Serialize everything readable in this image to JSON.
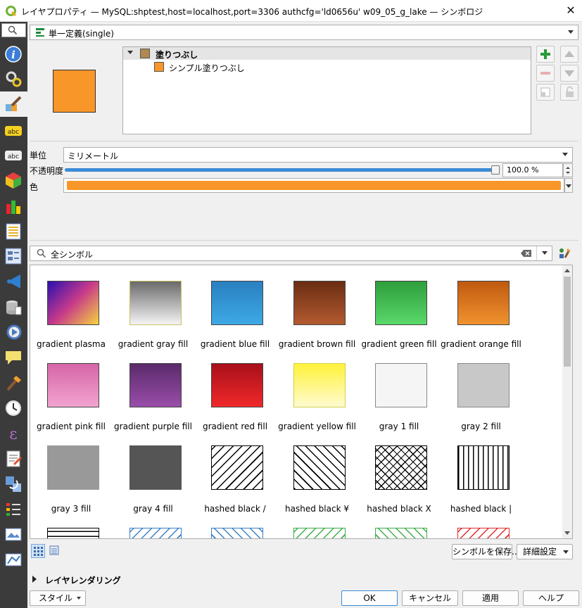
{
  "window": {
    "title": "レイヤプロパティ — MySQL:shptest,host=localhost,port=3306 authcfg='ld0656u' w09_05_g_lake — シンボロジ"
  },
  "renderer": {
    "value": "単一定義(single)"
  },
  "tree": {
    "parent": "塗りつぶし",
    "child": "シンプル塗りつぶし"
  },
  "fields": {
    "unit_label": "単位",
    "unit_value": "ミリメートル",
    "opacity_label": "不透明度",
    "opacity_value": "100.0 %",
    "opacity_fraction": 1.0,
    "color_label": "色",
    "color_value": "#f8962a"
  },
  "search": {
    "value": "全シンボル"
  },
  "symbols": [
    {
      "name": "gradient   plasma",
      "fill": "linear-gradient(135deg,#2b0fb0 0%,#c73a8a 50%,#f6d43c 100%)"
    },
    {
      "name": "gradient  gray fill",
      "fill": "linear-gradient(180deg,#6a6a6a,#f4f4f4)",
      "border": "#c8c060"
    },
    {
      "name": "gradient blue fill",
      "fill": "linear-gradient(180deg,#2a7fc0,#3ea9e6)"
    },
    {
      "name": "gradient brown fill",
      "fill": "linear-gradient(180deg,#6a2d12,#b45a30)"
    },
    {
      "name": "gradient green fill",
      "fill": "linear-gradient(180deg,#2e9e3c,#5ad86a)"
    },
    {
      "name": "gradient orange fill",
      "fill": "linear-gradient(180deg,#c05a10,#f0922e)"
    },
    {
      "name": "gradient pink fill",
      "fill": "linear-gradient(180deg,#d665a8,#f2a4cf)"
    },
    {
      "name": "gradient purple fill",
      "fill": "linear-gradient(180deg,#5a2a6a,#9a4eaa)"
    },
    {
      "name": "gradient red fill",
      "fill": "linear-gradient(180deg,#a8101a,#f0282a)"
    },
    {
      "name": "gradient yellow fill",
      "fill": "linear-gradient(180deg,#fff23a,#fffbd0)",
      "border": "#d0d050"
    },
    {
      "name": "gray 1 fill",
      "fill": "#f5f5f5",
      "border": "#888"
    },
    {
      "name": "gray 2 fill",
      "fill": "#c8c8c8",
      "border": "#888"
    },
    {
      "name": "gray 3 fill",
      "fill": "#999999",
      "border": "#999"
    },
    {
      "name": "gray 4 fill",
      "fill": "#555555",
      "border": "#555"
    },
    {
      "name": "hashed black /",
      "fill": "repeating-linear-gradient(-45deg,#000 0 1.5px,#fff 1.5px 9px)",
      "border": "#000"
    },
    {
      "name": "hashed black ¥",
      "fill": "repeating-linear-gradient(45deg,#000 0 1.5px,#fff 1.5px 9px)",
      "border": "#000"
    },
    {
      "name": "hashed black X",
      "fill": "repeating-linear-gradient(45deg,#000 0 1.2px,transparent 1.2px 8px),repeating-linear-gradient(-45deg,#000 0 1.2px,#fff 1.2px 8px)",
      "border": "#000"
    },
    {
      "name": "hashed black |",
      "fill": "repeating-linear-gradient(90deg,#000 0 1.5px,#fff 1.5px 7px)",
      "border": "#000"
    },
    {
      "name": "",
      "fill": "repeating-linear-gradient(0deg,#000 0 1.5px,#fff 1.5px 7px)",
      "border": "#000"
    },
    {
      "name": "",
      "fill": "repeating-linear-gradient(-45deg,#3a7fc4 0 1.5px,#fff 1.5px 9px)",
      "border": "#3a7fc4"
    },
    {
      "name": "",
      "fill": "repeating-linear-gradient(45deg,#3a7fc4 0 1.5px,#fff 1.5px 9px)",
      "border": "#3a7fc4"
    },
    {
      "name": "",
      "fill": "repeating-linear-gradient(-45deg,#3cae4a 0 1.5px,#fff 1.5px 9px)",
      "border": "#3cae4a"
    },
    {
      "name": "",
      "fill": "repeating-linear-gradient(45deg,#3cae4a 0 1.5px,#fff 1.5px 9px)",
      "border": "#3cae4a"
    },
    {
      "name": "",
      "fill": "repeating-linear-gradient(-45deg,#e02a2a 0 1.5px,#fff 1.5px 9px)",
      "border": "#e02a2a"
    }
  ],
  "buttons": {
    "save_symbol": "シンボルを保存...",
    "advanced": "詳細設定",
    "layer_rendering": "レイヤレンダリング",
    "style": "スタイル",
    "ok": "OK",
    "cancel": "キャンセル",
    "apply": "適用",
    "help": "ヘルプ"
  },
  "colors": {
    "symbol_fill": "#f8962a",
    "selection": "#3c8bd6",
    "sidebar": "#3b3b3b"
  }
}
